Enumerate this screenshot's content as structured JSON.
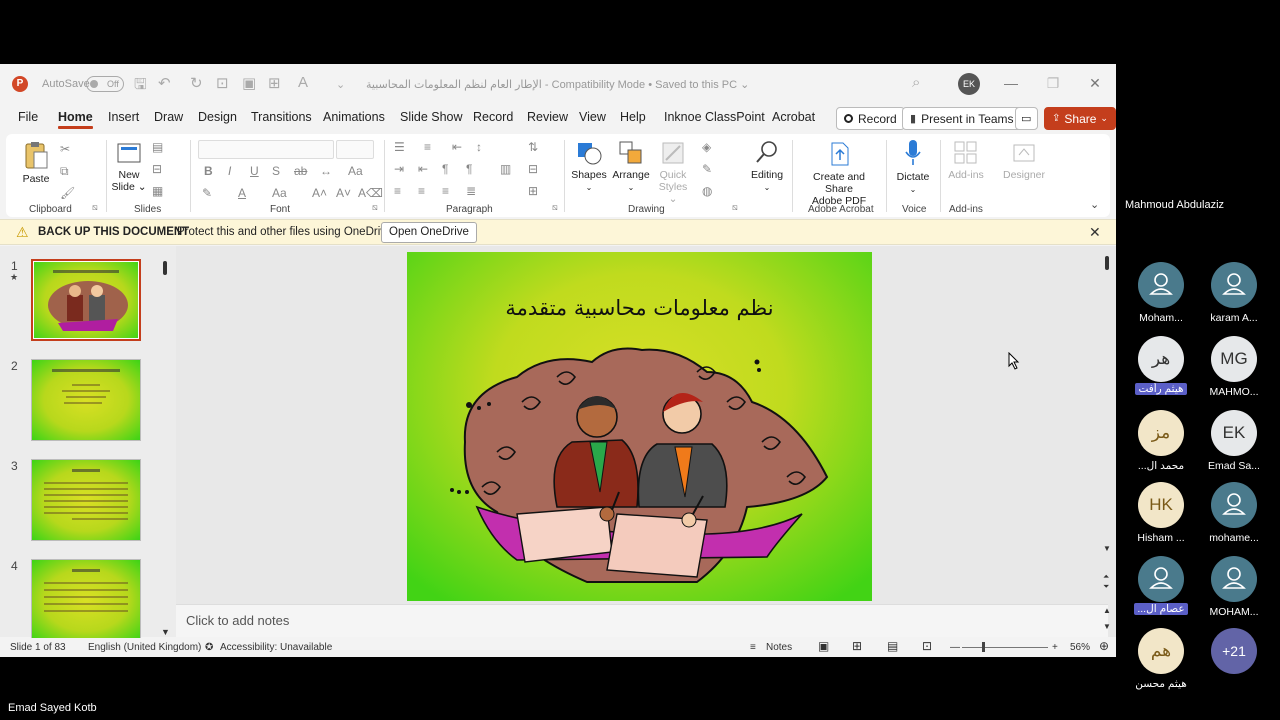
{
  "titlebar": {
    "autosave_label": "AutoSave",
    "autosave_state": "Off",
    "doc_title": "الإطار العام لنظم المعلومات المحاسبية  -  Compatibility Mode • Saved to this PC ⌄",
    "user_initials": "EK"
  },
  "menu": {
    "tabs": [
      "File",
      "Home",
      "Insert",
      "Draw",
      "Design",
      "Transitions",
      "Animations",
      "Slide Show",
      "Record",
      "Review",
      "View",
      "Help",
      "Inknoe ClassPoint",
      "Acrobat"
    ],
    "active_tab": "Home",
    "record_label": "Record",
    "present_label": "Present in Teams",
    "share_label": "Share"
  },
  "ribbon": {
    "groups": [
      "Clipboard",
      "Slides",
      "Font",
      "Paragraph",
      "Drawing",
      "Adobe Acrobat",
      "Voice",
      "Add-ins"
    ],
    "paste": "Paste",
    "new_slide_1": "New",
    "new_slide_2": "Slide ⌄",
    "shapes": "Shapes",
    "arrange": "Arrange",
    "quick_styles_1": "Quick",
    "quick_styles_2": "Styles ⌄",
    "editing": "Editing",
    "create_share_1": "Create and Share",
    "create_share_2": "Adobe PDF",
    "dictate": "Dictate",
    "addins": "Add-ins",
    "designer": "Designer"
  },
  "notification": {
    "title": "BACK UP THIS DOCUMENT",
    "message": "Protect this and other files using OneDrive.",
    "button": "Open OneDrive"
  },
  "thumbnails": [
    {
      "num": "1",
      "selected": true
    },
    {
      "num": "2",
      "selected": false
    },
    {
      "num": "3",
      "selected": false
    },
    {
      "num": "4",
      "selected": false
    }
  ],
  "slide": {
    "title": "نظم معلومات محاسبية متقدمة"
  },
  "notes_placeholder": "Click to add notes",
  "status": {
    "slide_info": "Slide 1 of 83",
    "language": "English (United Kingdom)",
    "accessibility": "Accessibility: Unavailable",
    "notes": "Notes",
    "zoom": "56%"
  },
  "teams": {
    "presenter": "Mahmoud Abdulaziz",
    "participants": [
      {
        "initials": "",
        "name": "Moham...",
        "style": "generic"
      },
      {
        "initials": "",
        "name": "karam A...",
        "style": "generic"
      },
      {
        "initials": "هر",
        "name": "هيثم رأفت",
        "style": "light",
        "tag": true
      },
      {
        "initials": "MG",
        "name": "MAHMO...",
        "style": "light"
      },
      {
        "initials": "مز",
        "name": "...محمد ال",
        "style": "gold"
      },
      {
        "initials": "EK",
        "name": "Emad Sa...",
        "style": "light"
      },
      {
        "initials": "HK",
        "name": "Hisham ...",
        "style": "gold"
      },
      {
        "initials": "",
        "name": "mohame...",
        "style": "generic"
      },
      {
        "initials": "",
        "name": "...عصام ال",
        "style": "generic",
        "tag": true
      },
      {
        "initials": "",
        "name": "MOHAM...",
        "style": "generic"
      },
      {
        "initials": "هم",
        "name": "هيثم محسن",
        "style": "gold"
      },
      {
        "initials": "+21",
        "name": "",
        "style": "purple"
      }
    ],
    "bottom_name": "Emad Sayed Kotb"
  },
  "colors": {
    "accent": "#c43e1c",
    "slide_green": "#42d315",
    "slide_yellow": "#d8df27",
    "teams_purple": "#6264a7"
  }
}
